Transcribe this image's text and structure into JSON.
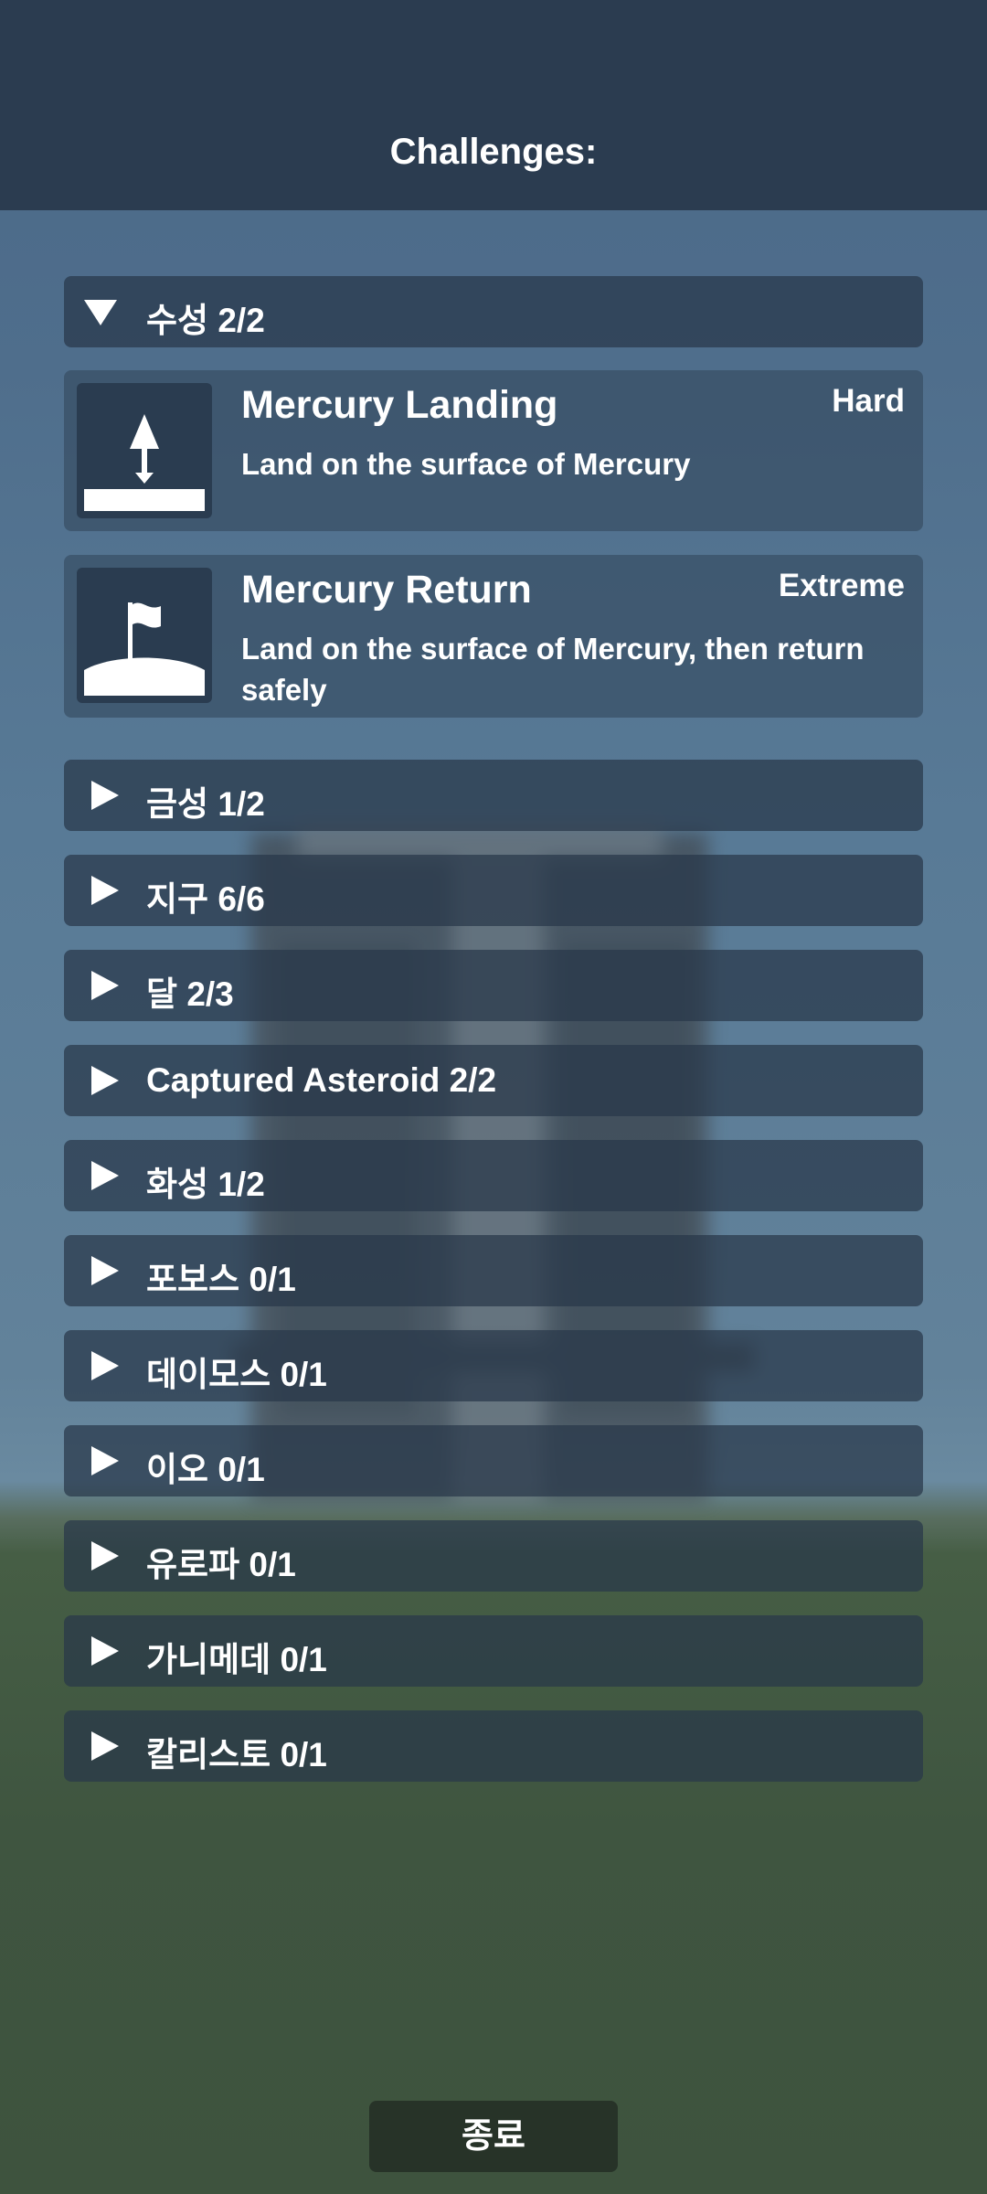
{
  "header": {
    "title": "Challenges:"
  },
  "expanded_group": {
    "label": "수성 2/2",
    "challenges": [
      {
        "title": "Mercury Landing",
        "difficulty": "Hard",
        "description": "Land on the surface of Mercury",
        "icon": "landing-icon"
      },
      {
        "title": "Mercury Return",
        "difficulty": "Extreme",
        "description": "Land on the surface of Mercury, then return safely",
        "icon": "flag-icon"
      }
    ]
  },
  "groups": [
    {
      "label": "금성 1/2"
    },
    {
      "label": "지구 6/6"
    },
    {
      "label": "달 2/3"
    },
    {
      "label": "Captured Asteroid 2/2"
    },
    {
      "label": "화성 1/2"
    },
    {
      "label": "포보스 0/1"
    },
    {
      "label": "데이모스 0/1"
    },
    {
      "label": "이오 0/1"
    },
    {
      "label": "유로파 0/1"
    },
    {
      "label": "가니메데 0/1"
    },
    {
      "label": "칼리스토 0/1"
    }
  ],
  "footer": {
    "exit_label": "종료"
  }
}
